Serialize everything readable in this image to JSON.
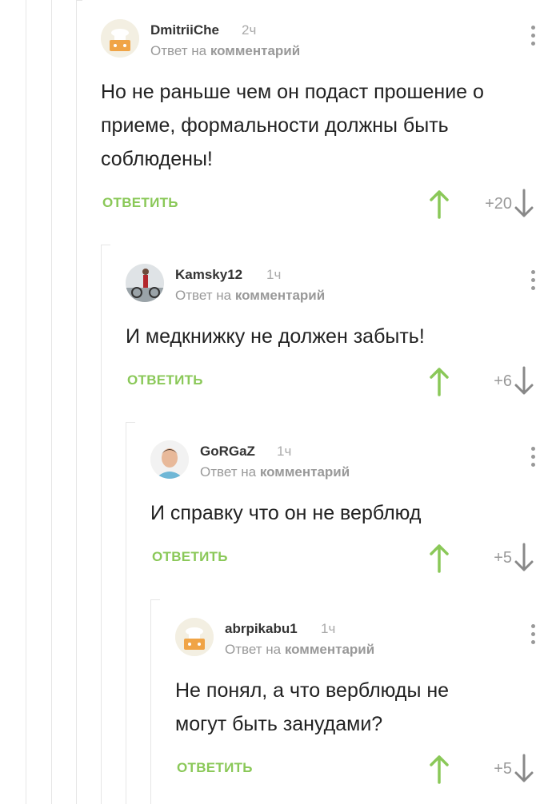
{
  "comments": [
    {
      "username": "DmitriiChe",
      "time": "2ч",
      "reply_prefix": "Ответ на",
      "reply_target": "комментарий",
      "text": "Но не раньше чем он подаст прошение о приеме, формальности должны быть соблюдены!",
      "reply_label": "ОТВЕТИТЬ",
      "score": "+20"
    },
    {
      "username": "Kamsky12",
      "time": "1ч",
      "reply_prefix": "Ответ на",
      "reply_target": "комментарий",
      "text": "И медкнижку не должен забыть!",
      "reply_label": "ОТВЕТИТЬ",
      "score": "+6"
    },
    {
      "username": "GoRGaZ",
      "time": "1ч",
      "reply_prefix": "Ответ на",
      "reply_target": "комментарий",
      "text": "И справку что он не верблюд",
      "reply_label": "ОТВЕТИТЬ",
      "score": "+5"
    },
    {
      "username": "abrpikabu1",
      "time": "1ч",
      "reply_prefix": "Ответ на",
      "reply_target": "комментарий",
      "text": "Не понял, а что верблюды не могут быть занудами?",
      "reply_label": "ОТВЕТИТЬ",
      "score": "+5"
    }
  ],
  "colors": {
    "reply": "#8ac858",
    "upvote": "#8ac858",
    "downvote": "#888888",
    "muted": "#999999"
  },
  "icons": {
    "menu": "vertical-dots-icon",
    "upvote": "arrow-up-icon",
    "downvote": "arrow-down-icon",
    "avatar_default": "pikabu-default-avatar-icon"
  }
}
